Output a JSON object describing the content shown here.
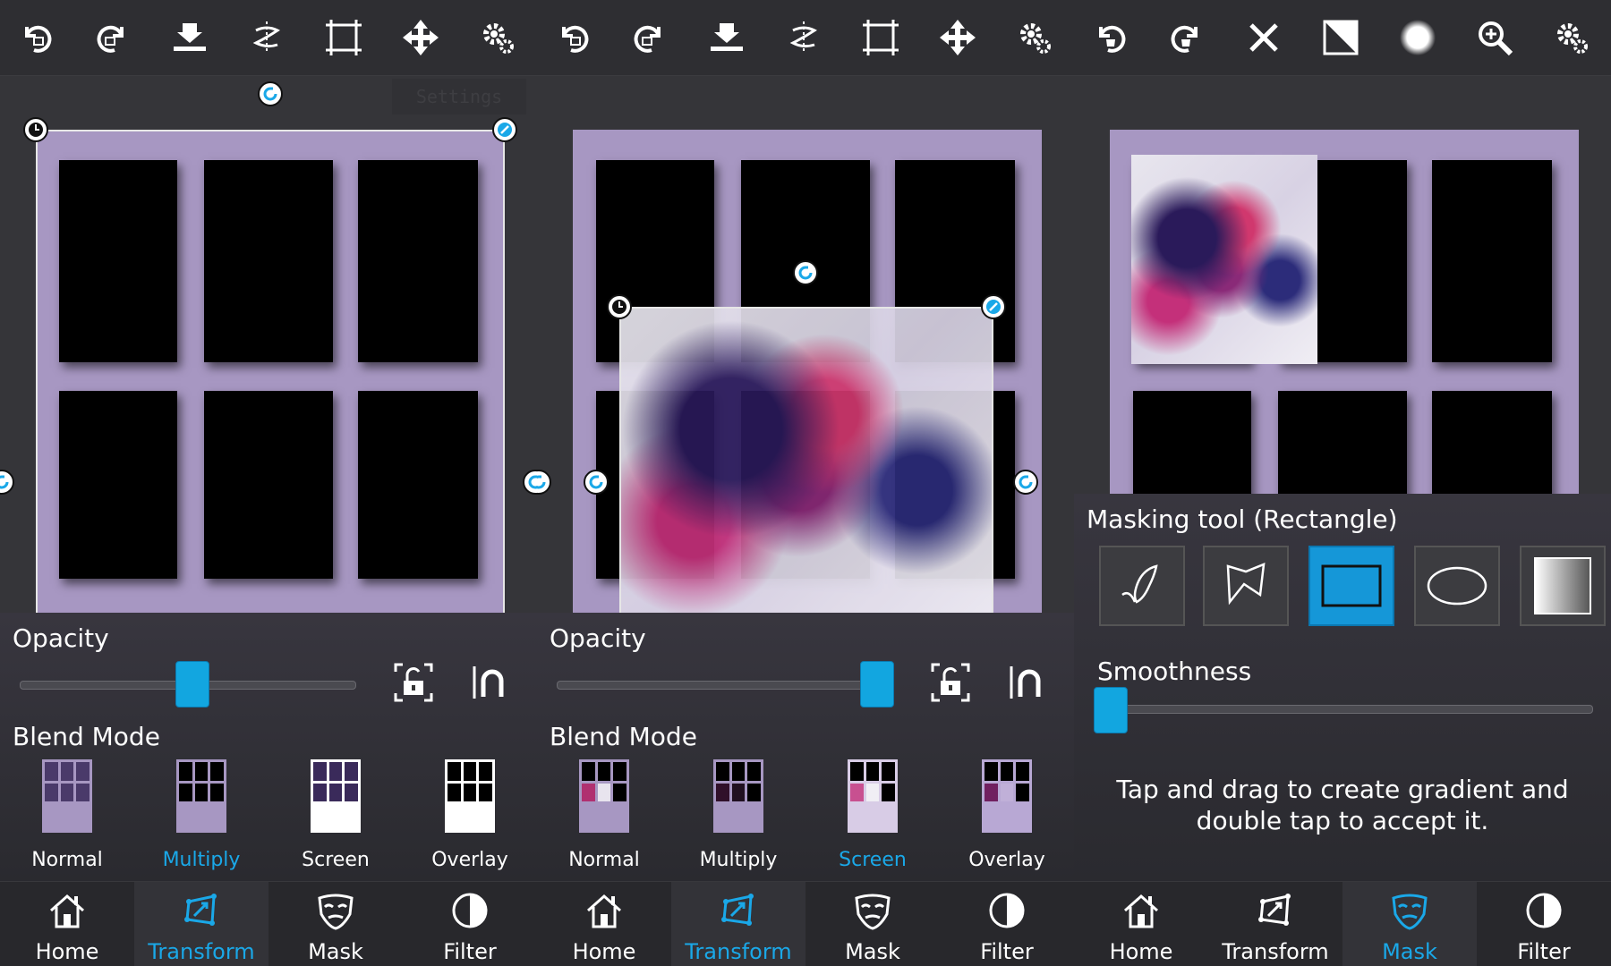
{
  "panels": [
    {
      "id": "transform-normal",
      "toolbar": [
        "undo-icon",
        "redo-icon",
        "merge-down-icon",
        "flip-icon",
        "fit-frame-icon",
        "move-icon",
        "settings-gear-icon"
      ],
      "settings_ghost": "Settings",
      "opacity_label": "Opacity",
      "opacity_value": 0.5,
      "blend_label": "Blend Mode",
      "blend_modes": [
        {
          "label": "Normal",
          "active": false
        },
        {
          "label": "Multiply",
          "active": true
        },
        {
          "label": "Screen",
          "active": false
        },
        {
          "label": "Overlay",
          "active": false
        }
      ],
      "nav": [
        {
          "label": "Home",
          "active": false
        },
        {
          "label": "Transform",
          "active": true
        },
        {
          "label": "Mask",
          "active": false
        },
        {
          "label": "Filter",
          "active": false
        }
      ]
    },
    {
      "id": "transform-screen",
      "toolbar": [
        "undo-icon",
        "redo-icon",
        "merge-down-icon",
        "flip-icon",
        "fit-frame-icon",
        "move-icon",
        "settings-gear-icon"
      ],
      "opacity_label": "Opacity",
      "opacity_value": 1.0,
      "blend_label": "Blend Mode",
      "blend_modes": [
        {
          "label": "Normal",
          "active": false
        },
        {
          "label": "Multiply",
          "active": false
        },
        {
          "label": "Screen",
          "active": true
        },
        {
          "label": "Overlay",
          "active": false
        }
      ],
      "nav": [
        {
          "label": "Home",
          "active": false
        },
        {
          "label": "Transform",
          "active": true
        },
        {
          "label": "Mask",
          "active": false
        },
        {
          "label": "Filter",
          "active": false
        }
      ]
    },
    {
      "id": "mask",
      "toolbar": [
        "mask-undo-icon",
        "mask-redo-icon",
        "clear-mask-icon",
        "invert-mask-icon",
        "brush-circle-icon",
        "zoom-in-icon",
        "settings-gear-icon"
      ],
      "masking_label": "Masking tool (Rectangle)",
      "tools": [
        {
          "name": "freehand-tool-icon",
          "active": false
        },
        {
          "name": "polygon-tool-icon",
          "active": false
        },
        {
          "name": "rectangle-tool-icon",
          "active": true
        },
        {
          "name": "ellipse-tool-icon",
          "active": false
        },
        {
          "name": "gradient-tool-icon",
          "active": false
        }
      ],
      "smoothness_label": "Smoothness",
      "smoothness_value": 0.0,
      "hint_line1": "Tap and drag to create gradient and",
      "hint_line2": "double tap to accept it.",
      "nav": [
        {
          "label": "Home",
          "active": false
        },
        {
          "label": "Transform",
          "active": false
        },
        {
          "label": "Mask",
          "active": true
        },
        {
          "label": "Filter",
          "active": false
        }
      ]
    }
  ],
  "colors": {
    "accent": "#1aa8e8",
    "board": "#a797c2",
    "panel": "#2b2b2f"
  }
}
